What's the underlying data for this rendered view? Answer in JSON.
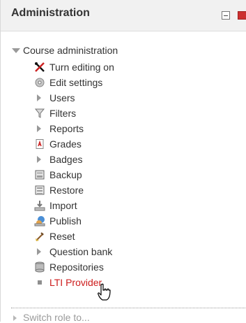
{
  "block": {
    "title": "Administration"
  },
  "course": {
    "label": "Course administration"
  },
  "items": [
    {
      "label": "Turn editing on",
      "icon": "edit-icon"
    },
    {
      "label": "Edit settings",
      "icon": "gear-icon"
    },
    {
      "label": "Users",
      "icon": "chevron-right-icon"
    },
    {
      "label": "Filters",
      "icon": "filter-icon"
    },
    {
      "label": "Reports",
      "icon": "chevron-right-icon"
    },
    {
      "label": "Grades",
      "icon": "grades-icon"
    },
    {
      "label": "Badges",
      "icon": "chevron-right-icon"
    },
    {
      "label": "Backup",
      "icon": "backup-icon"
    },
    {
      "label": "Restore",
      "icon": "restore-icon"
    },
    {
      "label": "Import",
      "icon": "import-icon"
    },
    {
      "label": "Publish",
      "icon": "publish-icon"
    },
    {
      "label": "Reset",
      "icon": "reset-icon"
    },
    {
      "label": "Question bank",
      "icon": "chevron-right-icon"
    },
    {
      "label": "Repositories",
      "icon": "repository-icon"
    },
    {
      "label": "LTI Provider",
      "icon": "bullet-icon"
    }
  ],
  "next": {
    "label": "Switch role to..."
  },
  "colors": {
    "active_link": "#cc1b1b",
    "header_bg": "#f1f1f1",
    "caret": "#999999"
  }
}
